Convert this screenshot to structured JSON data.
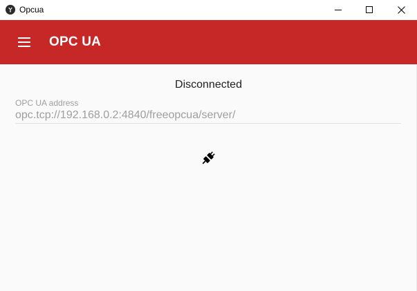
{
  "window": {
    "title": "Opcua"
  },
  "appbar": {
    "title": "OPC UA",
    "menu_icon": "menu-icon",
    "color": "#c62828"
  },
  "main": {
    "status": "Disconnected",
    "address_label": "OPC UA address",
    "address_value": "opc.tcp://192.168.0.2:4840/freeopcua/server/",
    "connect_icon": "plug-connect-icon"
  }
}
